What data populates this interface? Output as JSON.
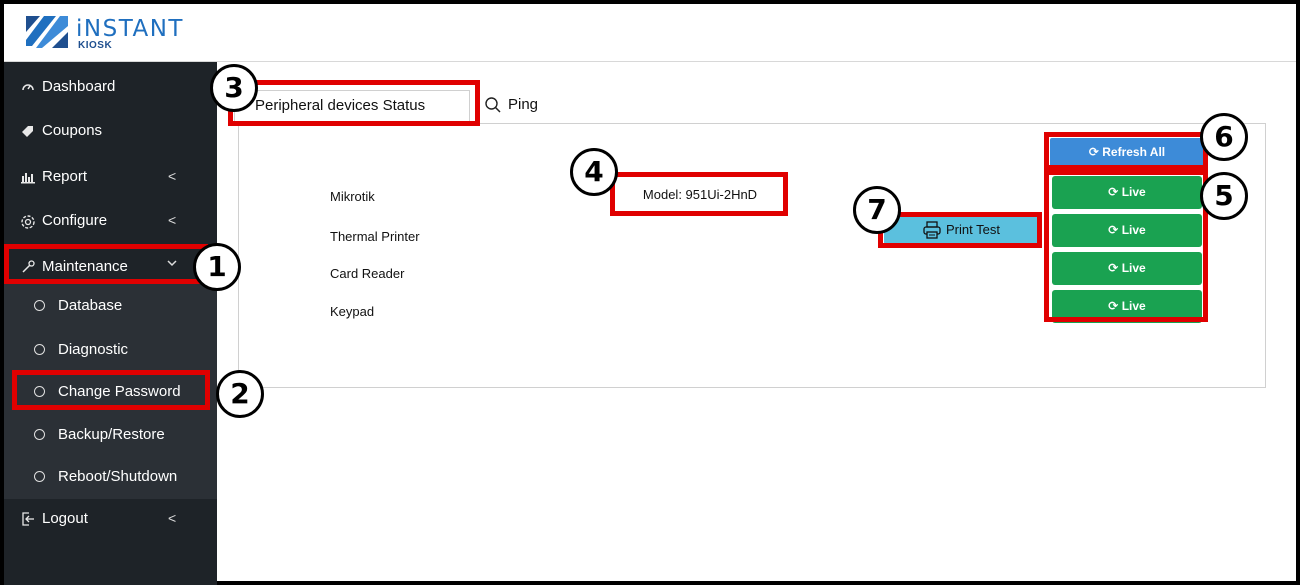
{
  "brand": {
    "name": "iNSTANT",
    "sub": "KIOSK",
    "color": "#1f6fbf"
  },
  "sidebar": {
    "items": [
      {
        "label": "Dashboard",
        "icon": "gauge-icon"
      },
      {
        "label": "Coupons",
        "icon": "tag-icon"
      },
      {
        "label": "Report",
        "icon": "bar-chart-icon",
        "chevron": "<"
      },
      {
        "label": "Configure",
        "icon": "gear-icon",
        "chevron": "<"
      },
      {
        "label": "Maintenance",
        "icon": "wrench-icon",
        "chevron": "v"
      },
      {
        "label": "Logout",
        "icon": "logout-icon",
        "chevron": "<"
      }
    ],
    "maintenance_sub": [
      {
        "label": "Database"
      },
      {
        "label": "Diagnostic"
      },
      {
        "label": "Change Password"
      },
      {
        "label": "Backup/Restore"
      },
      {
        "label": "Reboot/Shutdown"
      }
    ]
  },
  "tabs": [
    {
      "label": "Peripheral devices Status",
      "active": true
    },
    {
      "label": "Ping",
      "icon": "search-icon"
    }
  ],
  "devices": [
    {
      "name": "Mikrotik",
      "detail": "Model: 951Ui-2HnD"
    },
    {
      "name": "Thermal Printer"
    },
    {
      "name": "Card Reader"
    },
    {
      "name": "Keypad"
    }
  ],
  "buttons": {
    "refresh_all": "Refresh All",
    "live": [
      "Live",
      "Live",
      "Live",
      "Live"
    ],
    "print_test": "Print Test"
  },
  "callouts": [
    "1",
    "2",
    "3",
    "4",
    "5",
    "6",
    "7"
  ],
  "colors": {
    "sidebar_bg": "#1e2328",
    "live_green": "#1aa251",
    "refresh_blue": "#3d8bd8",
    "print_cyan": "#5bc0de",
    "highlight_red": "#e00000"
  }
}
